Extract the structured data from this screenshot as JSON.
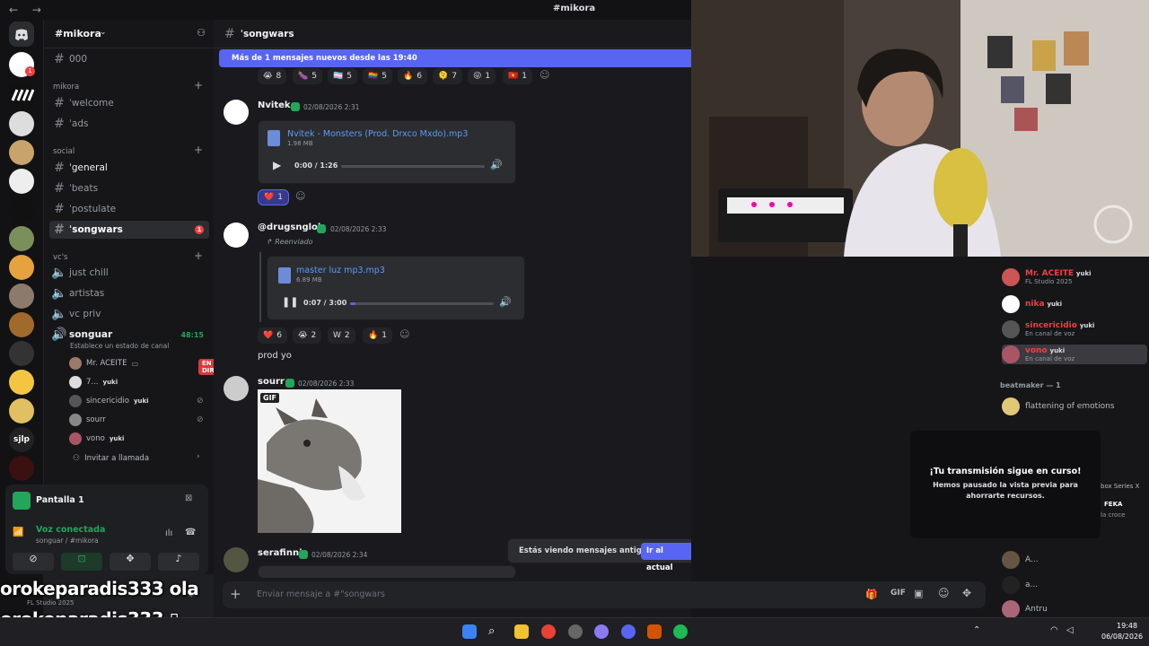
{
  "titlebar": {
    "nav": "← →",
    "title": "#mikora"
  },
  "server": {
    "name": "#mikora"
  },
  "channels": {
    "top": [
      {
        "label": "000"
      }
    ],
    "cat_mikora": "mikora",
    "mikora": [
      {
        "label": "ˈwelcome"
      },
      {
        "label": "ˈads"
      }
    ],
    "cat_social": "social",
    "social": [
      {
        "label": "ˈgeneral"
      },
      {
        "label": "ˈbeats"
      },
      {
        "label": "ˈpostulate"
      },
      {
        "label": "ˈsongwars",
        "badge": "1"
      }
    ],
    "cat_vcs": "vc's",
    "voice": [
      {
        "label": "just chill"
      },
      {
        "label": "artistas"
      },
      {
        "label": "vc priv"
      }
    ],
    "active_voice": {
      "label": "songuar",
      "timer": "48:15",
      "status": "Establece un estado de canal"
    },
    "voice_users": [
      {
        "name": "Mr. ACEITE",
        "tag": "",
        "live": "EN DIRECTO"
      },
      {
        "name": "7...",
        "tag": "yuki",
        "live": ""
      },
      {
        "name": "sincericidio",
        "tag": "yuki",
        "live": ""
      },
      {
        "name": "sourr",
        "tag": "",
        "live": ""
      },
      {
        "name": "vono",
        "tag": "yuki",
        "live": ""
      }
    ],
    "invite": "Invitar a llamada"
  },
  "panel": {
    "screen": "Pantalla 1",
    "voice_title": "Voz conectada",
    "voice_sub": "songuar / #mikora",
    "user_status": "FL Studio 2025"
  },
  "overlay": {
    "line1": "orokeparadis333  ola",
    "line2": "orokeparadis333  ▯"
  },
  "chat": {
    "channel": "ˈsongwars",
    "newbar": "Más de 1 mensajes nuevos desde las 19:40",
    "reacts_top": [
      {
        "e": "😭",
        "n": "8"
      },
      {
        "e": "🍆",
        "n": "5"
      },
      {
        "e": "🏳️‍⚧️",
        "n": "5"
      },
      {
        "e": "🏳️‍🌈",
        "n": "5"
      },
      {
        "e": "🔥",
        "n": "6"
      },
      {
        "e": "🫠",
        "n": "7"
      },
      {
        "e": "😜",
        "n": "1"
      },
      {
        "e": "🇻🇳",
        "n": "1"
      }
    ],
    "msg1": {
      "user": "Nvitek",
      "time": "02/08/2026 2:31",
      "file": "Nvitek - Monsters (Prod. Drxco Mxdo).mp3",
      "size": "1.98 MB",
      "ptime": "0:00 / 1:26",
      "progress": 0,
      "react": {
        "e": "❤️",
        "n": "1"
      }
    },
    "msg2": {
      "user": "@drugsnglok",
      "time": "02/08/2026 2:33",
      "fwd": "Reenviado",
      "file": "master luz mp3.mp3",
      "size": "6.89 MB",
      "ptime": "0:07 / 3:00",
      "progress": 0.04,
      "reacts": [
        {
          "e": "❤️",
          "n": "6"
        },
        {
          "e": "😭",
          "n": "2"
        },
        {
          "e": "W",
          "n": "2"
        },
        {
          "e": "🔥",
          "n": "1"
        }
      ],
      "text": "prod yo"
    },
    "msg3": {
      "user": "sourr",
      "time": "02/08/2026 2:33",
      "gif": "GIF"
    },
    "msg4": {
      "user": "serafinni",
      "time": "02/08/2026 2:34"
    },
    "oldbar": {
      "text": "Estás viendo mensajes antiguos",
      "button": "Ir al actual"
    },
    "composer": {
      "placeholder": "Enviar mensaje a #\"songwars"
    }
  },
  "members": {
    "list": [
      {
        "name": "Mr. ACEITE",
        "tag": "yuki",
        "sub": "FL Studio 2025",
        "color": "#f23f42"
      },
      {
        "name": "nika",
        "tag": "yuki",
        "sub": "",
        "color": "#f23f42"
      },
      {
        "name": "sincericidio",
        "tag": "yuki",
        "sub": "En canal de voz",
        "color": "#f23f42"
      },
      {
        "name": "vono",
        "tag": "yuki",
        "sub": "En canal de voz",
        "color": "#f23f42"
      }
    ],
    "cat": "beatmaker — 1",
    "beatmaker": [
      {
        "name": "flattening of emotions"
      }
    ],
    "tail": [
      {
        "name": "A..."
      },
      {
        "name": "a..."
      },
      {
        "name": "Antru"
      }
    ],
    "partial1": "box Series X",
    "partial2": "FEKA",
    "partial3": "la croce"
  },
  "stream_popup": {
    "title": "¡Tu transmisión sigue en curso!",
    "body": "Hemos pausado la vista previa para ahorrarte recursos."
  },
  "taskbar": {
    "time": "19:48",
    "date": "06/08/2026"
  }
}
